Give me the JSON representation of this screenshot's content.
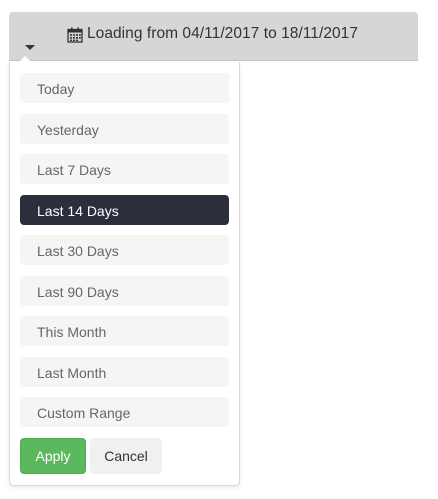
{
  "range_bar": {
    "icon": "calendar-icon",
    "text": "Loading from 04/11/2017 to 18/11/2017",
    "caret_icon": "caret-down-icon"
  },
  "dropdown": {
    "ranges": [
      {
        "label": "Today",
        "active": false
      },
      {
        "label": "Yesterday",
        "active": false
      },
      {
        "label": "Last 7 Days",
        "active": false
      },
      {
        "label": "Last 14 Days",
        "active": true
      },
      {
        "label": "Last 30 Days",
        "active": false
      },
      {
        "label": "Last 90 Days",
        "active": false
      },
      {
        "label": "This Month",
        "active": false
      },
      {
        "label": "Last Month",
        "active": false
      },
      {
        "label": "Custom Range",
        "active": false
      }
    ],
    "apply_label": "Apply",
    "cancel_label": "Cancel"
  },
  "colors": {
    "bar_background": "#d6d6d6",
    "active_range": "#2a2f3b",
    "apply_button": "#5cb85c",
    "cancel_button": "#f0f0f0"
  }
}
